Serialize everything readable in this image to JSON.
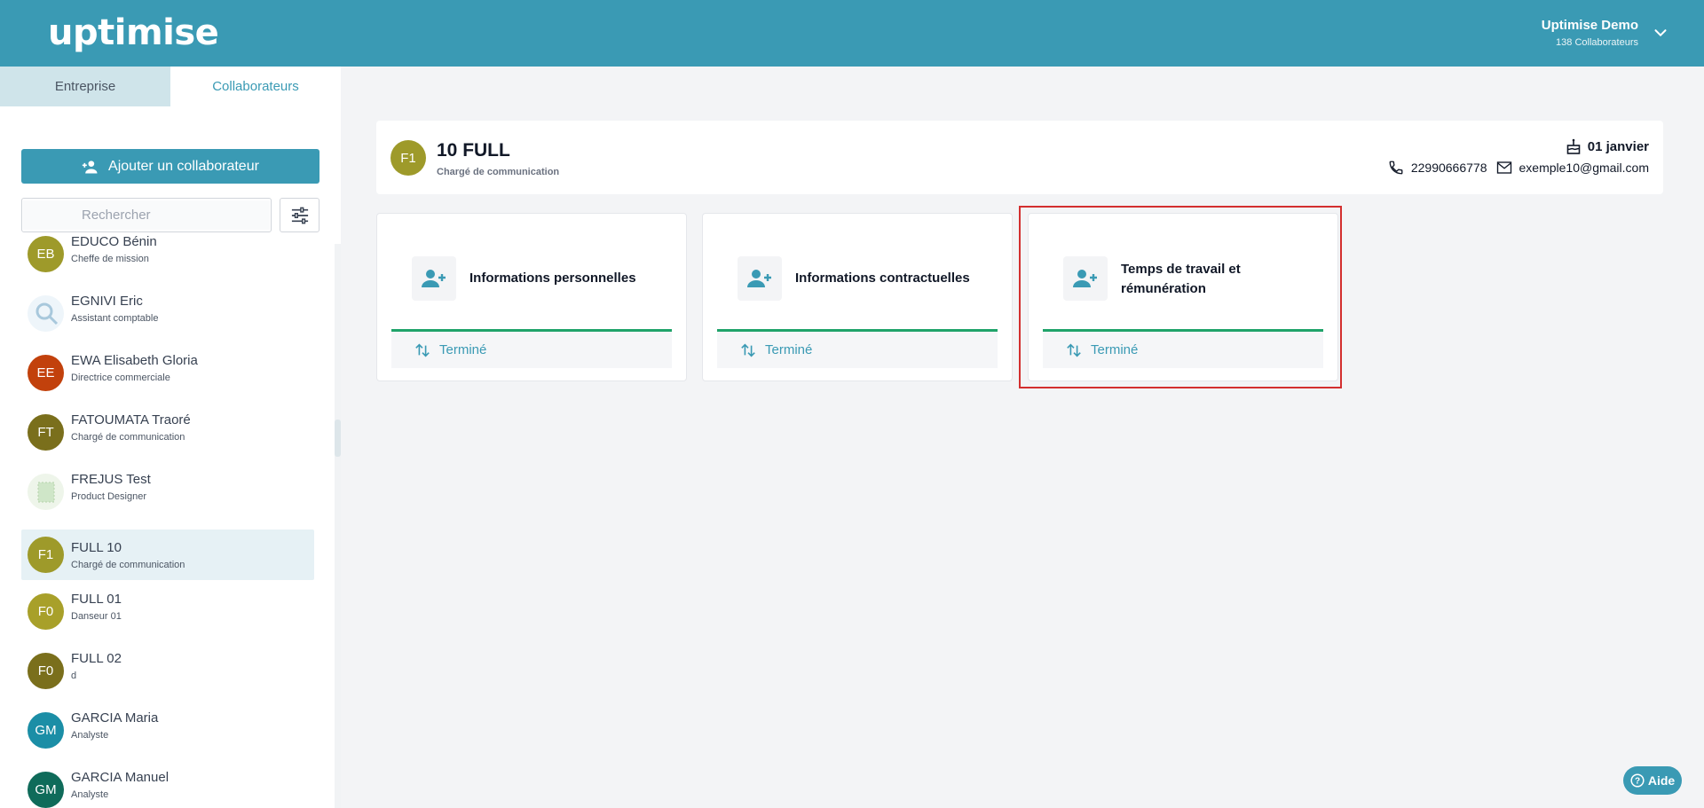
{
  "header": {
    "logo": "uptimise",
    "account_name": "Uptimise Demo",
    "account_sub": "138 Collaborateurs"
  },
  "sidebar": {
    "tabs": [
      {
        "label": "Entreprise",
        "active": false
      },
      {
        "label": "Collaborateurs",
        "active": true
      }
    ],
    "add_button": "Ajouter un collaborateur",
    "search_placeholder": "Rechercher",
    "items": [
      {
        "initials": "EB",
        "name": "EDUCO Bénin",
        "role": "Cheffe de mission",
        "color": "#9e9a2a",
        "photo": false
      },
      {
        "initials": "",
        "name": "EGNIVI Eric",
        "role": "Assistant comptable",
        "color": "#cfe3ef",
        "photo": true
      },
      {
        "initials": "EE",
        "name": "EWA Elisabeth Gloria",
        "role": "Directrice commerciale",
        "color": "#c2410c",
        "photo": false
      },
      {
        "initials": "FT",
        "name": "FATOUMATA Traoré",
        "role": "Chargé de communication",
        "color": "#7a6f1c",
        "photo": false
      },
      {
        "initials": "",
        "name": "FREJUS Test",
        "role": "Product Designer",
        "color": "#d9ead3",
        "photo": true
      },
      {
        "initials": "F1",
        "name": "FULL 10",
        "role": "Chargé de communication",
        "color": "#9e9a2a",
        "photo": false,
        "active": true
      },
      {
        "initials": "F0",
        "name": "FULL 01",
        "role": "Danseur 01",
        "color": "#a8a02a",
        "photo": false
      },
      {
        "initials": "F0",
        "name": "FULL 02",
        "role": "d",
        "color": "#7a6f1c",
        "photo": false
      },
      {
        "initials": "GM",
        "name": "GARCIA Maria",
        "role": "Analyste",
        "color": "#1b8ea6",
        "photo": false
      },
      {
        "initials": "GM",
        "name": "GARCIA Manuel",
        "role": "Analyste",
        "color": "#0f6b5a",
        "photo": false
      }
    ]
  },
  "profile": {
    "initials": "F1",
    "name": "10 FULL",
    "role": "Chargé de communication",
    "birthday": "01 janvier",
    "phone": "22990666778",
    "email": "exemple10@gmail.com"
  },
  "cards": [
    {
      "title": "Informations personnelles",
      "status": "Terminé"
    },
    {
      "title": "Informations contractuelles",
      "status": "Terminé"
    },
    {
      "title": "Temps de travail et rémunération",
      "status": "Terminé"
    }
  ],
  "help_label": "Aide",
  "colors": {
    "primary": "#3a9ab4",
    "progress": "#1fa36a",
    "highlight": "#d32f2f"
  }
}
